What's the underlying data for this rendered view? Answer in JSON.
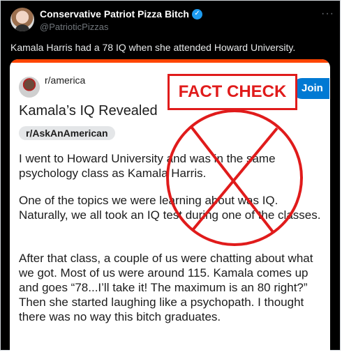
{
  "tweet": {
    "display_name": "Conservative Patriot Pizza Bitch",
    "verified_icon": "verified-badge-icon",
    "handle": "@PatrioticPizzas",
    "more_icon": "···",
    "text": "Kamala Harris had a 78 IQ when she attended Howard University."
  },
  "embed": {
    "subreddit": "r/america",
    "join_label": "Join",
    "title": "Kamala’s IQ Revealed",
    "flair": "r/AskAnAmerican",
    "paragraphs": [
      "I went to Howard University and was in the same psychology class as Kamala Harris.",
      "One of the topics we were learning about was IQ. Naturally, we all took an IQ test during one of the classes.",
      "After that class, a couple of us were chatting about what we got. Most of us were around 115. Kamala comes up and goes “78...I’ll take it! The maximum is an 80 right?” Then she started laughing like a psychopath. I thought there was no way this bitch graduates."
    ]
  },
  "overlay": {
    "label": "FACT CHECK",
    "color": "#e01b1b"
  },
  "colors": {
    "tweet_background": "#000000",
    "reddit_accent": "#ff4500",
    "join_button": "#0079d3",
    "verified": "#1d9bf0"
  }
}
